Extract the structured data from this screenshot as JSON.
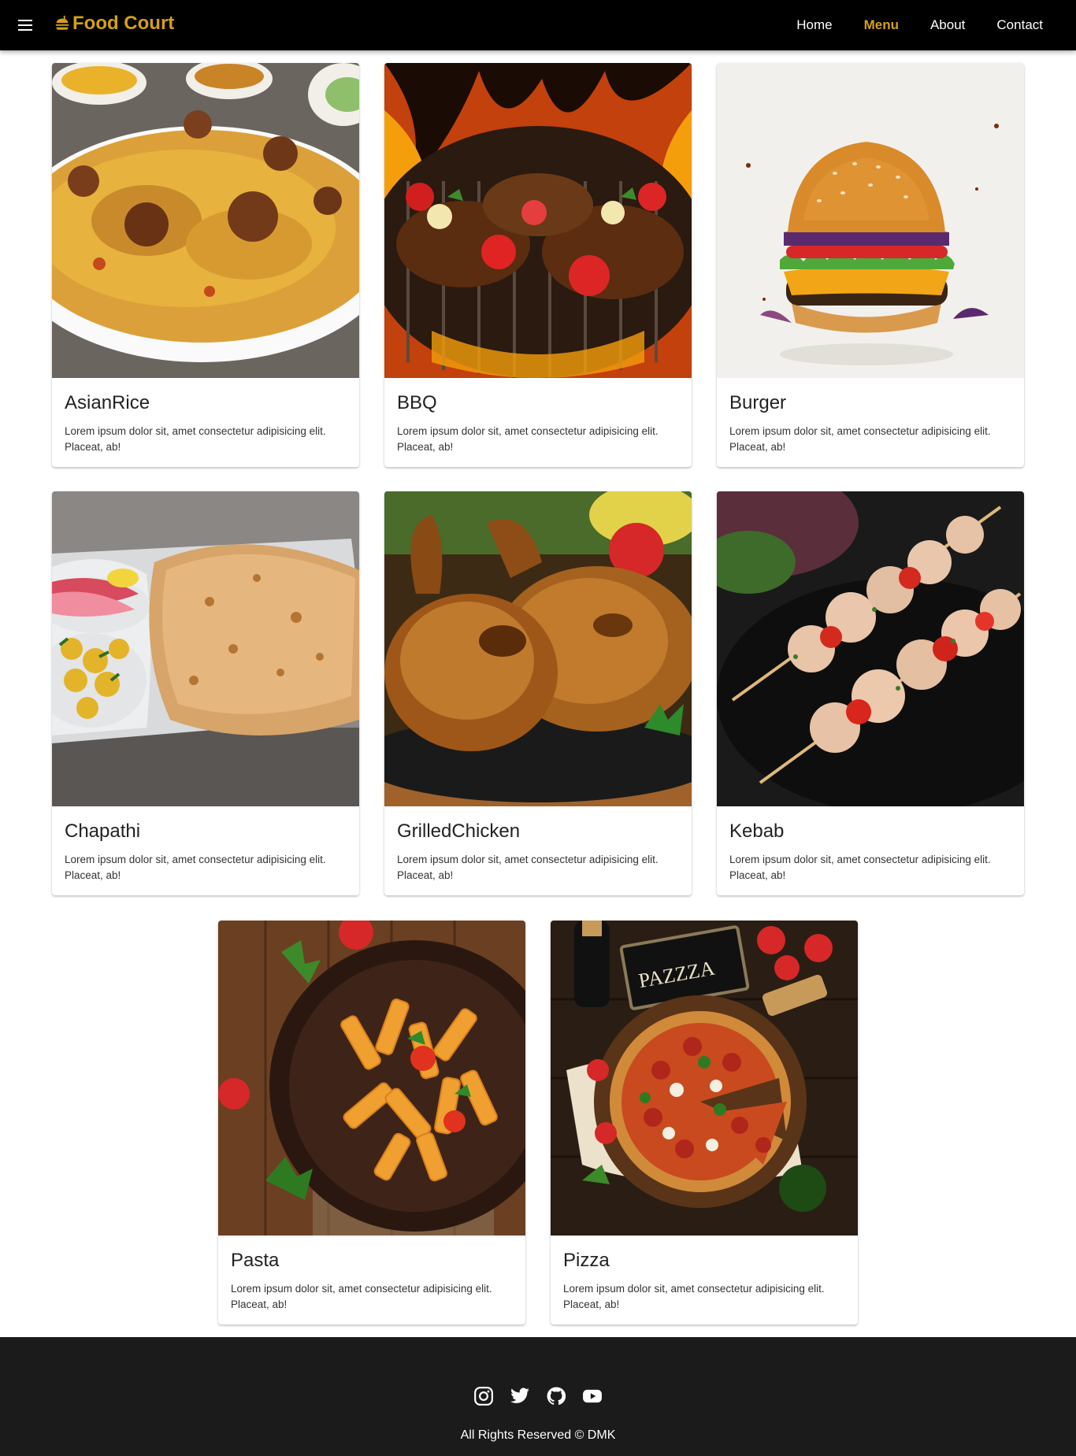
{
  "header": {
    "brand": "Food Court",
    "nav": [
      "Home",
      "Menu",
      "About",
      "Contact"
    ],
    "active_nav": "Menu",
    "accent_color": "#d4a017",
    "background_color": "#000000"
  },
  "menu": {
    "items": [
      {
        "title": "AsianRice",
        "description": "Lorem ipsum dolor sit, amet consectetur adipisicing elit. Placeat, ab!",
        "image": "asian-rice-photo"
      },
      {
        "title": "BBQ",
        "description": "Lorem ipsum dolor sit, amet consectetur adipisicing elit. Placeat, ab!",
        "image": "bbq-grill-photo"
      },
      {
        "title": "Burger",
        "description": "Lorem ipsum dolor sit, amet consectetur adipisicing elit. Placeat, ab!",
        "image": "burger-photo"
      },
      {
        "title": "Chapathi",
        "description": "Lorem ipsum dolor sit, amet consectetur adipisicing elit. Placeat, ab!",
        "image": "chapathi-plate-photo"
      },
      {
        "title": "GrilledChicken",
        "description": "Lorem ipsum dolor sit, amet consectetur adipisicing elit. Placeat, ab!",
        "image": "grilled-chicken-photo"
      },
      {
        "title": "Kebab",
        "description": "Lorem ipsum dolor sit, amet consectetur adipisicing elit. Placeat, ab!",
        "image": "kebab-skewers-photo"
      },
      {
        "title": "Pasta",
        "description": "Lorem ipsum dolor sit, amet consectetur adipisicing elit. Placeat, ab!",
        "image": "pasta-bowl-photo"
      },
      {
        "title": "Pizza",
        "description": "Lorem ipsum dolor sit, amet consectetur adipisicing elit. Placeat, ab!",
        "image": "pizza-board-photo"
      }
    ]
  },
  "footer": {
    "socials": [
      "instagram-icon",
      "twitter-icon",
      "github-icon",
      "youtube-icon"
    ],
    "copyright": "All Rights Reserved © DMK",
    "background_color": "#1b1b1b"
  }
}
